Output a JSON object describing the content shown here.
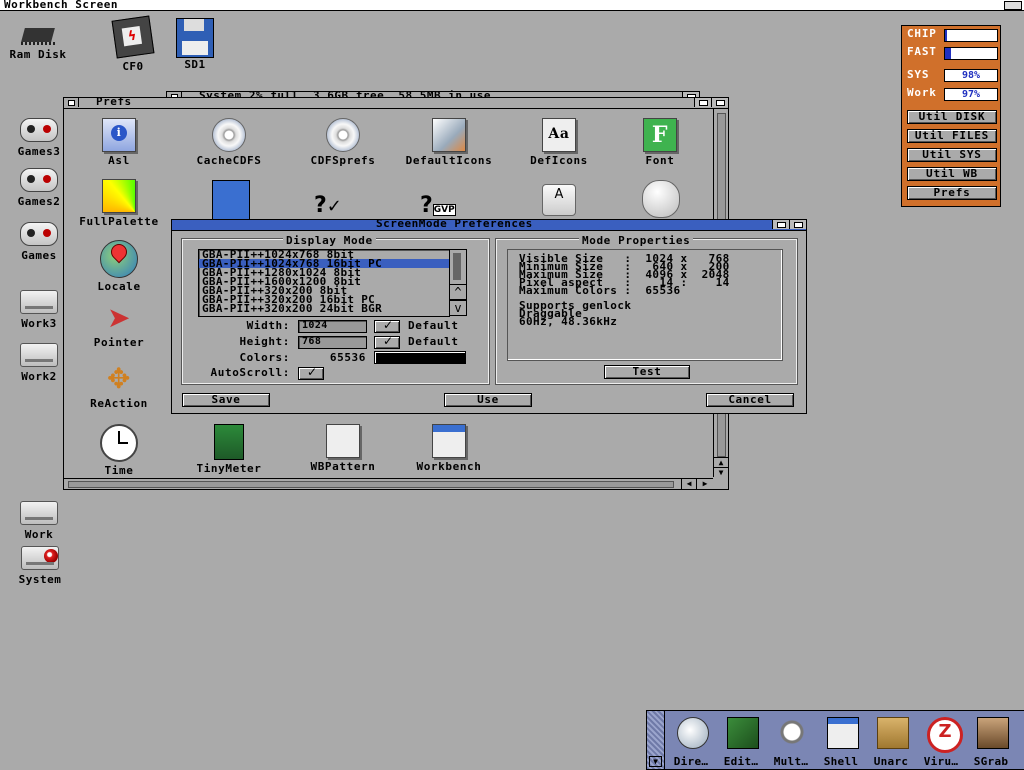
{
  "screen": {
    "title": "Workbench Screen"
  },
  "desktop_icons": [
    {
      "label": "Ram Disk",
      "icon": "ram-disk-icon"
    },
    {
      "label": "CF0",
      "icon": "cf-card-icon"
    },
    {
      "label": "SD1",
      "icon": "floppy-icon"
    },
    {
      "label": "Games3",
      "icon": "gamepad-drive-icon"
    },
    {
      "label": "Games2",
      "icon": "gamepad-drive-icon"
    },
    {
      "label": "Games",
      "icon": "gamepad-drive-icon"
    },
    {
      "label": "Work3",
      "icon": "harddisk-icon"
    },
    {
      "label": "Work2",
      "icon": "harddisk-icon"
    },
    {
      "label": "Work",
      "icon": "harddisk-icon"
    },
    {
      "label": "System",
      "icon": "system-disk-icon"
    }
  ],
  "system_window": {
    "title": "System  2% full, 3.6GB free, 58.5MB in use"
  },
  "prefs_window": {
    "title": "Prefs",
    "icons": [
      "Asl",
      "CacheCDFS",
      "CDFSprefs",
      "DefaultIcons",
      "DefIcons",
      "Font",
      "FullPalette",
      "",
      "",
      "",
      "",
      "",
      "Locale",
      "Pointer",
      "ReAction",
      "Time",
      "TinyMeter",
      "WBPattern",
      "Workbench"
    ]
  },
  "screenmode_dialog": {
    "title": "ScreenMode Preferences",
    "display_mode_label": "Display Mode",
    "modes": [
      "GBA-PII++1024x768  8bit",
      "GBA-PII++1024x768 16bit PC",
      "GBA-PII++1280x1024  8bit",
      "GBA-PII++1600x1200  8bit",
      "GBA-PII++320x200  8bit",
      "GBA-PII++320x200 16bit PC",
      "GBA-PII++320x200 24bit BGR"
    ],
    "selected_index": 1,
    "width_label": "Width:",
    "width_value": "1024",
    "height_label": "Height:",
    "height_value": "768",
    "default_label": "Default",
    "colors_label": "Colors:",
    "colors_value": "65536",
    "autoscroll_label": "AutoScroll:",
    "mode_properties_label": "Mode Properties",
    "properties": [
      "Visible Size   :  1024 x   768",
      "Minimum Size   :   640 x   200",
      "Maximum Size   :  4096 x  2048",
      "Pixel aspect   :    14 :    14",
      "Maximum Colors :  65536"
    ],
    "features": [
      "Supports genlock",
      "Draggable",
      "60Hz, 48.36kHz"
    ],
    "test_label": "Test",
    "save_label": "Save",
    "use_label": "Use",
    "cancel_label": "Cancel"
  },
  "monitor": {
    "chip_label": "CHIP",
    "fast_label": "FAST",
    "chip_fill": 0.03,
    "fast_fill": 0.12,
    "sys_label": "SYS",
    "sys_value": "98%",
    "work_label": "Work",
    "work_value": "97%",
    "buttons": [
      "Util DISK",
      "Util FILES",
      "Util SYS",
      "Util WB",
      "Prefs"
    ]
  },
  "dock": {
    "items": [
      "Dire…",
      "Edit…",
      "Mult…",
      "Shell",
      "Unarc",
      "Viru…",
      "SGrab"
    ]
  },
  "colors": {
    "desktop": "#aaaaaa",
    "selection": "#3a5fbf",
    "monitor": "#d0702b",
    "dock": "#7b86b4"
  }
}
